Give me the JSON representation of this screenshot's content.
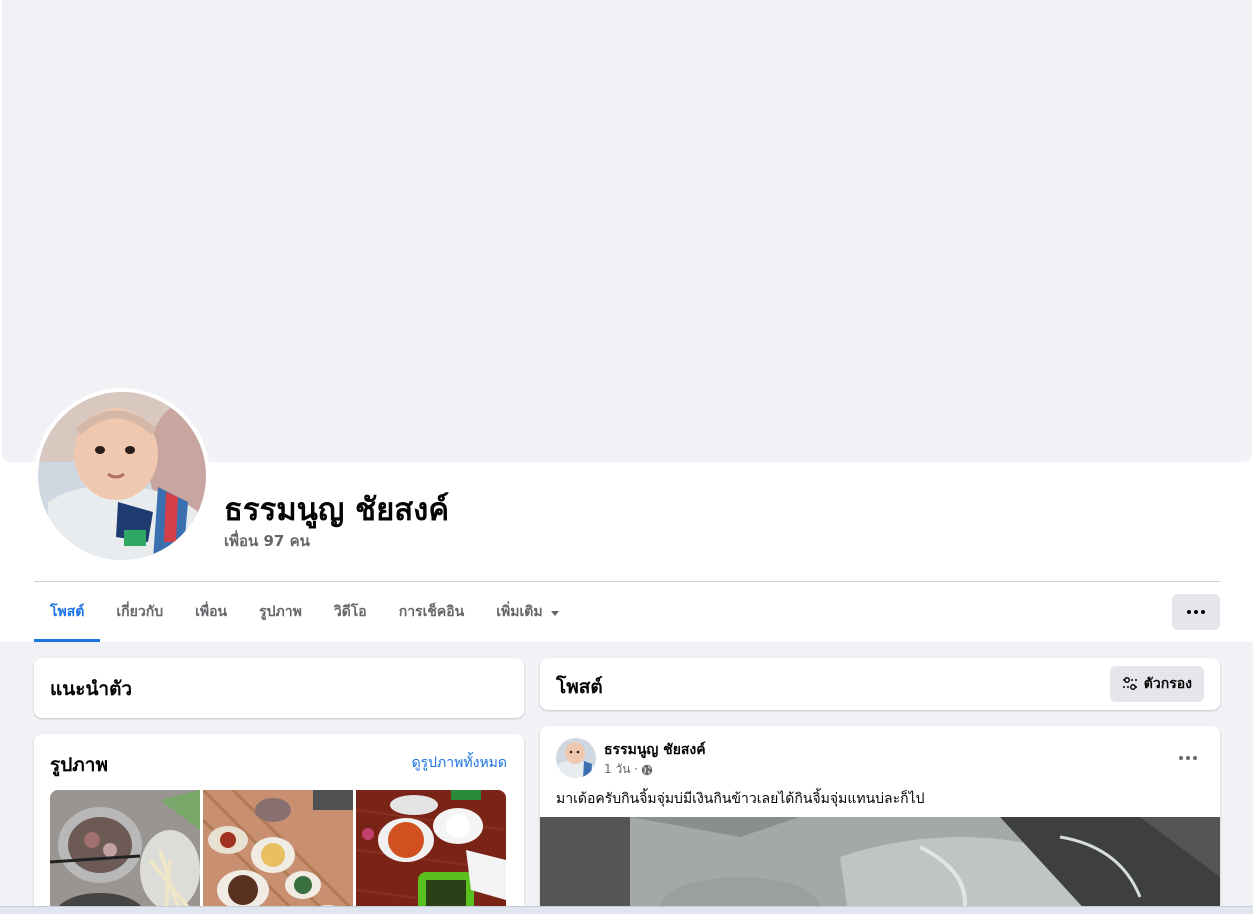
{
  "profile": {
    "name": "ธรรมนูญ ชัยสงค์",
    "friends": "เพื่อน 97 คน"
  },
  "tabs": [
    {
      "label": "โพสต์",
      "active": true
    },
    {
      "label": "เกี่ยวกับ",
      "active": false
    },
    {
      "label": "เพื่อน",
      "active": false
    },
    {
      "label": "รูปภาพ",
      "active": false
    },
    {
      "label": "วิดีโอ",
      "active": false
    },
    {
      "label": "การเช็คอิน",
      "active": false
    },
    {
      "label": "เพิ่มเติม",
      "active": false
    }
  ],
  "intro": {
    "title": "แนะนำตัว"
  },
  "photos": {
    "title": "รูปภาพ",
    "see_all": "ดูรูปภาพทั้งหมด"
  },
  "posts_header": {
    "title": "โพสต์",
    "filter_label": "ตัวกรอง"
  },
  "post": {
    "author": "ธรรมนูญ ชัยสงค์",
    "time": "1 วัน ·",
    "text": "มาเด้อครับกินจิ้มจุ่มบ่มีเงินกินข้าวเลยได้กินจิ้มจุ่มแทนบ่ละก็ไป"
  },
  "icons": {
    "more": "more-horizontal-icon",
    "filter": "sliders-icon",
    "privacy": "globe-icon",
    "dropdown": "caret-down-icon"
  },
  "colors": {
    "accent": "#1b74e4",
    "text_secondary": "#65676b",
    "page_bg": "#f0f2f5",
    "button_bg": "#e4e6eb"
  }
}
